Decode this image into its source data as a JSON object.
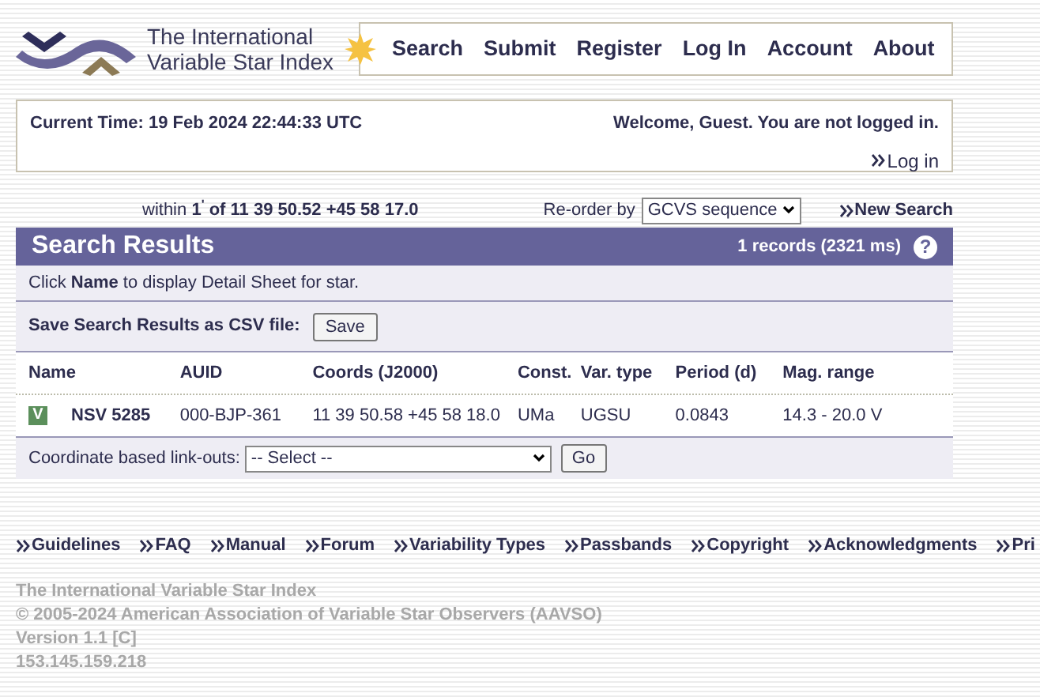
{
  "logo": {
    "title_lines": [
      "The International",
      "Variable Star Index"
    ]
  },
  "nav": [
    "Search",
    "Submit",
    "Register",
    "Log In",
    "Account",
    "About"
  ],
  "info": {
    "time": "Current Time: 19 Feb 2024 22:44:33 UTC",
    "welcome": "Welcome, Guest. You are not logged in.",
    "login_link": "Log in"
  },
  "query": {
    "summary": "within **1$^{'}$ of 11 39 50.52 +45 58 17.0**",
    "reorder_label": "Re-order by",
    "reorder_value": "GCVS sequence",
    "new_search": "New Search"
  },
  "results": {
    "title": "Search Results",
    "count": "1 records (2321 ms)",
    "help": "?",
    "hint": "Click **Name** to display Detail Sheet for star.",
    "csv_label": "Save Search Results as CSV file:",
    "save_button": "Save",
    "columns": [
      "Name",
      "AUID",
      "Coords (J2000)",
      "Const.",
      "Var. type",
      "Period (d)",
      "Mag. range"
    ],
    "rows": [
      {
        "badge": "V",
        "cells": [
          "NSV 5285",
          "000-BJP-361",
          "11 39 50.58 +45 58 18.0",
          "UMa",
          "UGSU",
          "0.0843",
          "14.3 - 20.0 V"
        ]
      }
    ],
    "linkouts_label": "Coordinate based link-outs:",
    "linkouts_value": "-- Select --",
    "go_button": "Go"
  },
  "footer_links": [
    "Guidelines",
    "FAQ",
    "Manual",
    "Forum",
    "Variability Types",
    "Passbands",
    "Copyright",
    "Acknowledgments",
    "Pri"
  ],
  "footer_lines": [
    "The International Variable Star Index",
    "© 2005-2024 American Association of Variable Star Observers (AAVSO)",
    "Version 1.1 [C]",
    "153.145.159.218"
  ]
}
